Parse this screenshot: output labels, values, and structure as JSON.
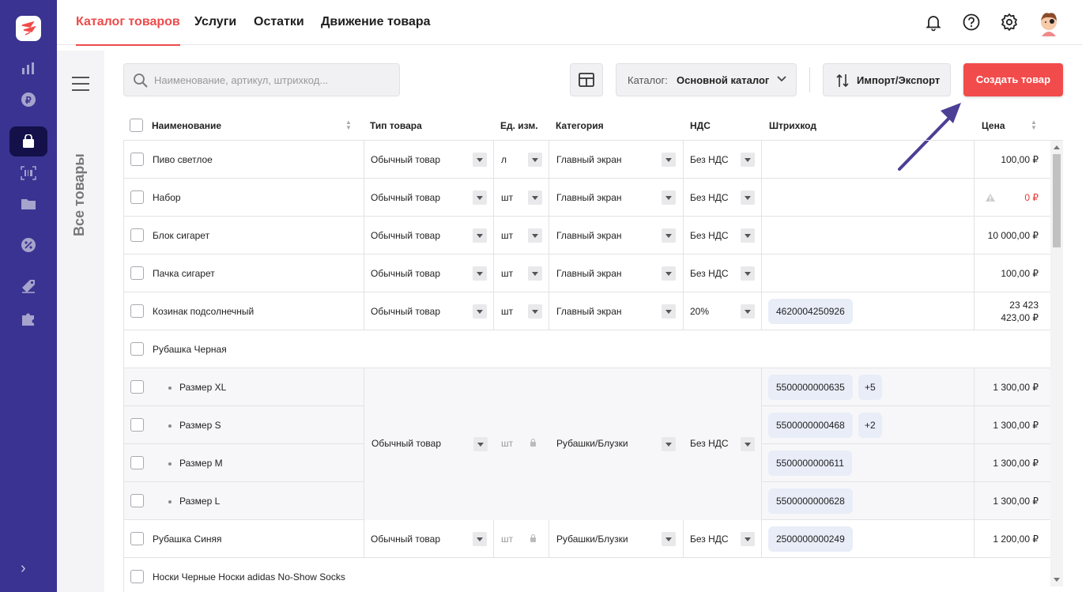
{
  "nav": {
    "tabs": [
      "Каталог товаров",
      "Услуги",
      "Остатки",
      "Движение товара"
    ],
    "active_tab": "Каталог товаров"
  },
  "sidebar": {
    "items": [
      "analytics-icon",
      "ruble-icon",
      "shopping-bag-icon",
      "barcode-icon",
      "folder-icon",
      "discount-icon",
      "tag-icon",
      "puzzle-icon"
    ],
    "active": "shopping-bag-icon"
  },
  "panel": {
    "title": "Все товары"
  },
  "toolbar": {
    "search_placeholder": "Наименование, артикул, штрихкод...",
    "catalog_label": "Каталог:",
    "catalog_value": "Основной каталог",
    "import_label": "Импорт/Экспорт",
    "create_label": "Создать товар"
  },
  "table": {
    "headers": {
      "name": "Наименование",
      "type": "Тип товара",
      "unit": "Ед. изм.",
      "category": "Категория",
      "vat": "НДС",
      "barcode": "Штрихкод",
      "price": "Цена"
    },
    "rows": [
      {
        "name": "Пиво светлое",
        "type": "Обычный товар",
        "unit": "л",
        "category": "Главный экран",
        "vat": "Без НДС",
        "barcode": "",
        "price": "100,00 ₽"
      },
      {
        "name": "Набор",
        "type": "Обычный товар",
        "unit": "шт",
        "category": "Главный экран",
        "vat": "Без НДС",
        "barcode": "",
        "price": "0 ₽",
        "warning": true
      },
      {
        "name": "Блок сигарет",
        "type": "Обычный товар",
        "unit": "шт",
        "category": "Главный экран",
        "vat": "Без НДС",
        "barcode": "",
        "price": "10 000,00 ₽"
      },
      {
        "name": "Пачка сигарет",
        "type": "Обычный товар",
        "unit": "шт",
        "category": "Главный экран",
        "vat": "Без НДС",
        "barcode": "",
        "price": "100,00 ₽"
      },
      {
        "name": "Козинак подсолнечный",
        "type": "Обычный товар",
        "unit": "шт",
        "category": "Главный экран",
        "vat": "20%",
        "barcode": "4620004250926",
        "price_line1": "23 423",
        "price_line2": "423,00 ₽"
      },
      {
        "name": "Рубашка Черная"
      }
    ],
    "variant_group": {
      "type": "Обычный товар",
      "unit": "шт",
      "category": "Рубашки/Блузки",
      "vat": "Без НДС",
      "variants": [
        {
          "name": "Размер XL",
          "barcode": "5500000000635",
          "extra": "+5",
          "price": "1 300,00 ₽"
        },
        {
          "name": "Размер S",
          "barcode": "5500000000468",
          "extra": "+2",
          "price": "1 300,00 ₽"
        },
        {
          "name": "Размер M",
          "barcode": "5500000000611",
          "price": "1 300,00 ₽"
        },
        {
          "name": "Размер L",
          "barcode": "5500000000628",
          "price": "1 300,00 ₽"
        }
      ]
    },
    "rows_after": [
      {
        "name": "Рубашка Синяя",
        "type": "Обычный товар",
        "unit": "шт",
        "category": "Рубашки/Блузки",
        "vat": "Без НДС",
        "barcode": "2500000000249",
        "price": "1 200,00 ₽"
      },
      {
        "name": "Носки Черные Носки adidas No-Show Socks"
      }
    ]
  },
  "colors": {
    "sidebar": "#3a3391",
    "accent": "#f24b4b",
    "arrow": "#4b3f96"
  }
}
